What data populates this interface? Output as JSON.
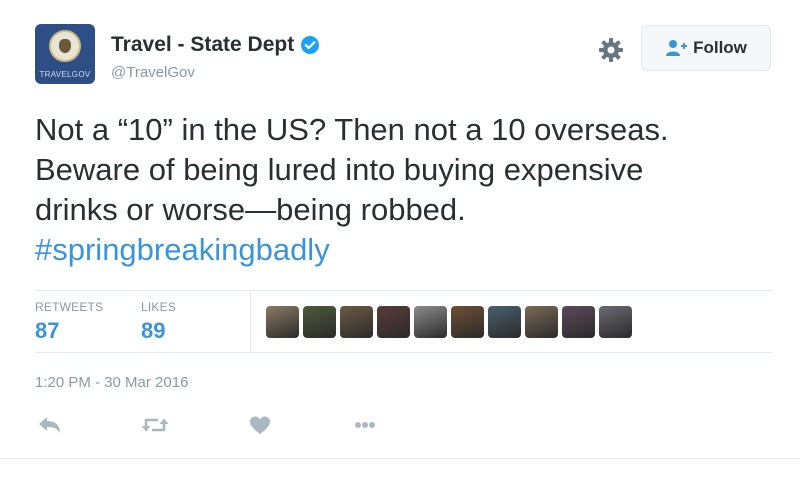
{
  "account": {
    "name": "Travel - State Dept",
    "handle": "@TravelGov",
    "avatar_tag": "TRAVELGOV",
    "verified": true
  },
  "header": {
    "settings_icon": "gear-icon",
    "follow_label": "Follow",
    "follow_icon": "add-user-icon"
  },
  "tweet": {
    "lines": [
      "Not a “10” in the US? Then not a 10 overseas.",
      "Beware of being lured into buying expensive",
      "drinks or worse—being robbed."
    ],
    "hashtag": "#springbreakingbadly"
  },
  "stats": {
    "retweets_label": "RETWEETS",
    "retweets": "87",
    "likes_label": "LIKES",
    "likes": "89"
  },
  "likers": [
    "#8a7a62",
    "#4d5a37",
    "#6b5a44",
    "#5a3a3a",
    "#8c8c8c",
    "#6e4f33",
    "#4a5f6e",
    "#7a6a55",
    "#5c4a5a",
    "#6a6a72"
  ],
  "timestamp": "1:20 PM - 30 Mar 2016",
  "actions": [
    "reply-icon",
    "retweet-icon",
    "like-icon",
    "more-icon"
  ],
  "colors": {
    "link": "#3b94d9",
    "text": "#292f33",
    "muted": "#8899a6",
    "verified": "#1da1f2",
    "border": "#e1e8ed"
  }
}
